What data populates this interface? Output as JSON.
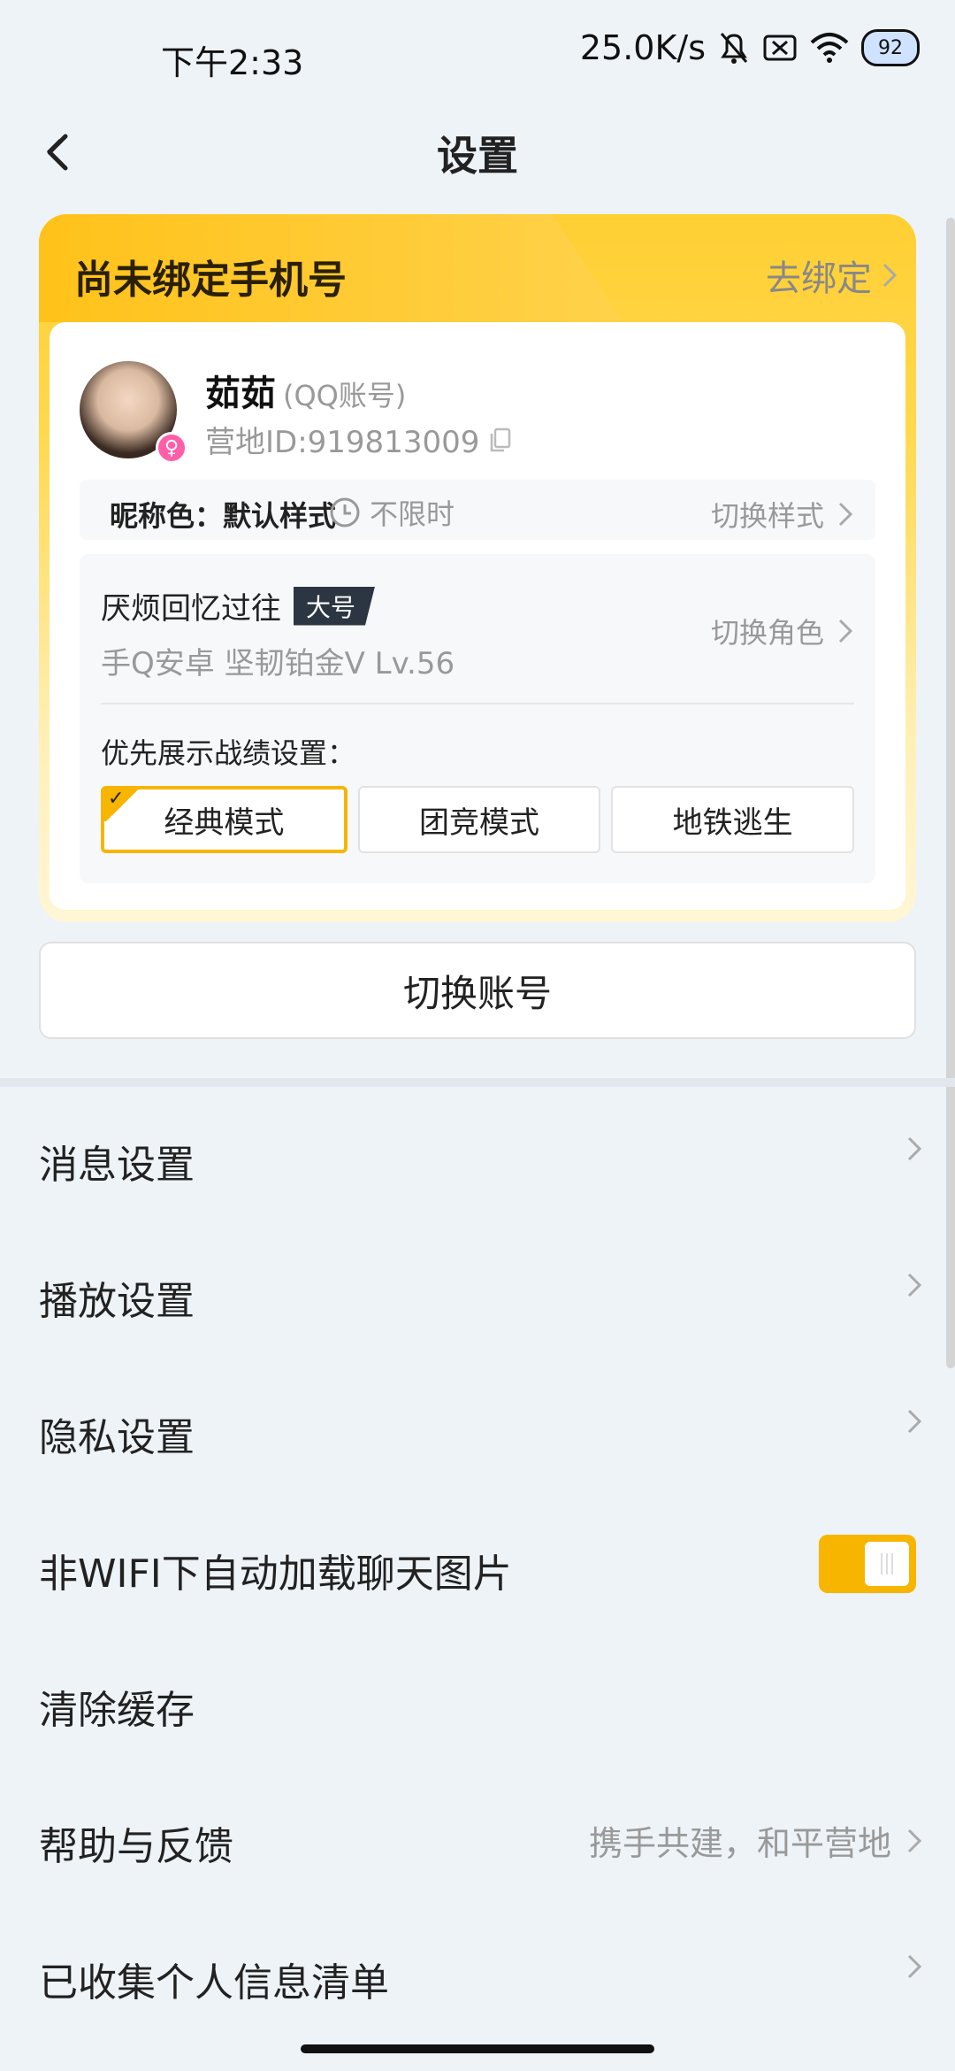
{
  "status_bar": {
    "time": "下午2:33",
    "net_speed": "25.0K/s",
    "battery": "92",
    "icons": [
      "bell-off-icon",
      "sim-off-icon",
      "wifi-icon",
      "battery-icon"
    ]
  },
  "nav": {
    "title": "设置",
    "back_icon": "back-arrow-icon"
  },
  "bind_card": {
    "title": "尚未绑定手机号",
    "bind_link": "去绑定",
    "user": {
      "name": "茹茹",
      "account_type": "(QQ账号)",
      "camp_id": "营地ID:919813009",
      "gender": "female"
    },
    "nick_color": {
      "label": "昵称色：默认样式",
      "duration": "不限时",
      "switch": "切换样式"
    },
    "role": {
      "name": "厌烦回忆过往",
      "badge": "大号",
      "meta": "手Q安卓  坚韧铂金V  Lv.56",
      "switch": "切换角色"
    },
    "prefer_label": "优先展示战绩设置：",
    "modes": [
      {
        "label": "经典模式",
        "active": true
      },
      {
        "label": "团竞模式",
        "active": false
      },
      {
        "label": "地铁逃生",
        "active": false
      }
    ]
  },
  "switch_account": "切换账号",
  "settings": [
    {
      "label": "消息设置",
      "right": ""
    },
    {
      "label": "播放设置",
      "right": ""
    },
    {
      "label": "隐私设置",
      "right": ""
    },
    {
      "label": "非WIFI下自动加载聊天图片",
      "toggle": true
    },
    {
      "label": "清除缓存",
      "right": ""
    },
    {
      "label": "帮助与反馈",
      "right": "携手共建，和平营地"
    },
    {
      "label": "已收集个人信息清单",
      "right": ""
    }
  ],
  "colors": {
    "accent": "#f7b500",
    "background": "#eef3f8"
  }
}
